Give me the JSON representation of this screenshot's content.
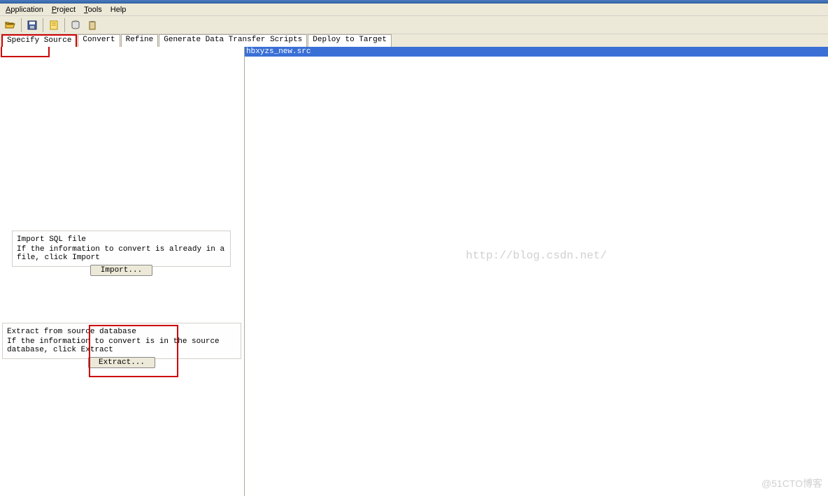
{
  "menu": {
    "application": "Application",
    "project": "Project",
    "tools": "Tools",
    "help": "Help"
  },
  "tabs": {
    "specify_source": "Specify Source",
    "convert": "Convert",
    "refine": "Refine",
    "generate_scripts": "Generate Data Transfer Scripts",
    "deploy": "Deploy to Target"
  },
  "import_group": {
    "title": "Import SQL file",
    "desc": "If the information to convert is already in a file, click Import",
    "button": "Import..."
  },
  "extract_group": {
    "title": "Extract from source database",
    "desc": "If the information to convert is in the source database, click Extract",
    "button": "Extract..."
  },
  "right_header": "hbxyzs_new.src",
  "watermark_center": "http://blog.csdn.net/",
  "watermark_corner": "@51CTO博客",
  "icons": {
    "open": "open-folder-icon",
    "save": "save-floppy-icon",
    "note": "sticky-note-icon",
    "sql": "sql-icon",
    "clipboard": "clipboard-icon"
  }
}
